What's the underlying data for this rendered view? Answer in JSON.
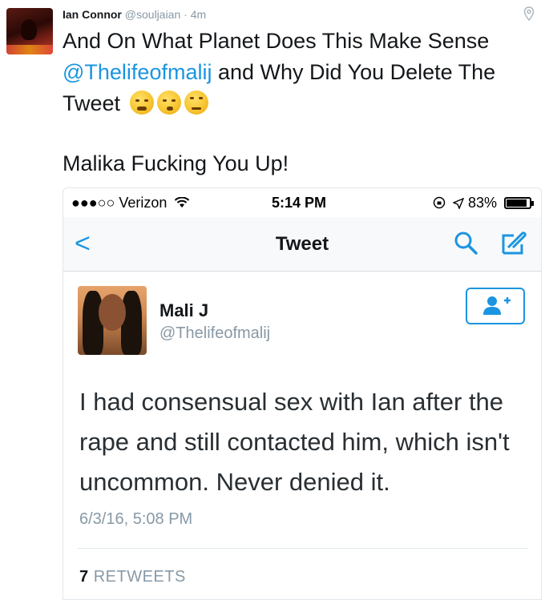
{
  "tweet": {
    "author_name": "Ian Connor",
    "author_handle": "@souljaian",
    "time": "· 4m",
    "text_part1": "And On What Planet Does This Make Sense ",
    "mention": "@Thelifeofmalij",
    "text_part2": " and Why Did You Delete The Tweet",
    "text_line2": "Malika Fucking You Up!",
    "emojis": [
      "weary-face-icon",
      "thinking-face-icon",
      "eye-roll-face-icon"
    ]
  },
  "screenshot": {
    "status_bar": {
      "carrier": "●●●○○ Verizon",
      "time": "5:14 PM",
      "battery": "83%"
    },
    "nav": {
      "back": "<",
      "title": "Tweet"
    },
    "embedded_tweet": {
      "name": "Mali J",
      "handle": "@Thelifeofmalij",
      "text": "I had consensual sex with Ian after the rape and still contacted him, which isn't uncommon. Never denied it.",
      "date": "6/3/16, 5:08 PM",
      "retweets_count": "7",
      "retweets_label": "RETWEETS"
    }
  },
  "colors": {
    "accent": "#1b95e0",
    "muted": "#8899a6",
    "text": "#14171a"
  }
}
